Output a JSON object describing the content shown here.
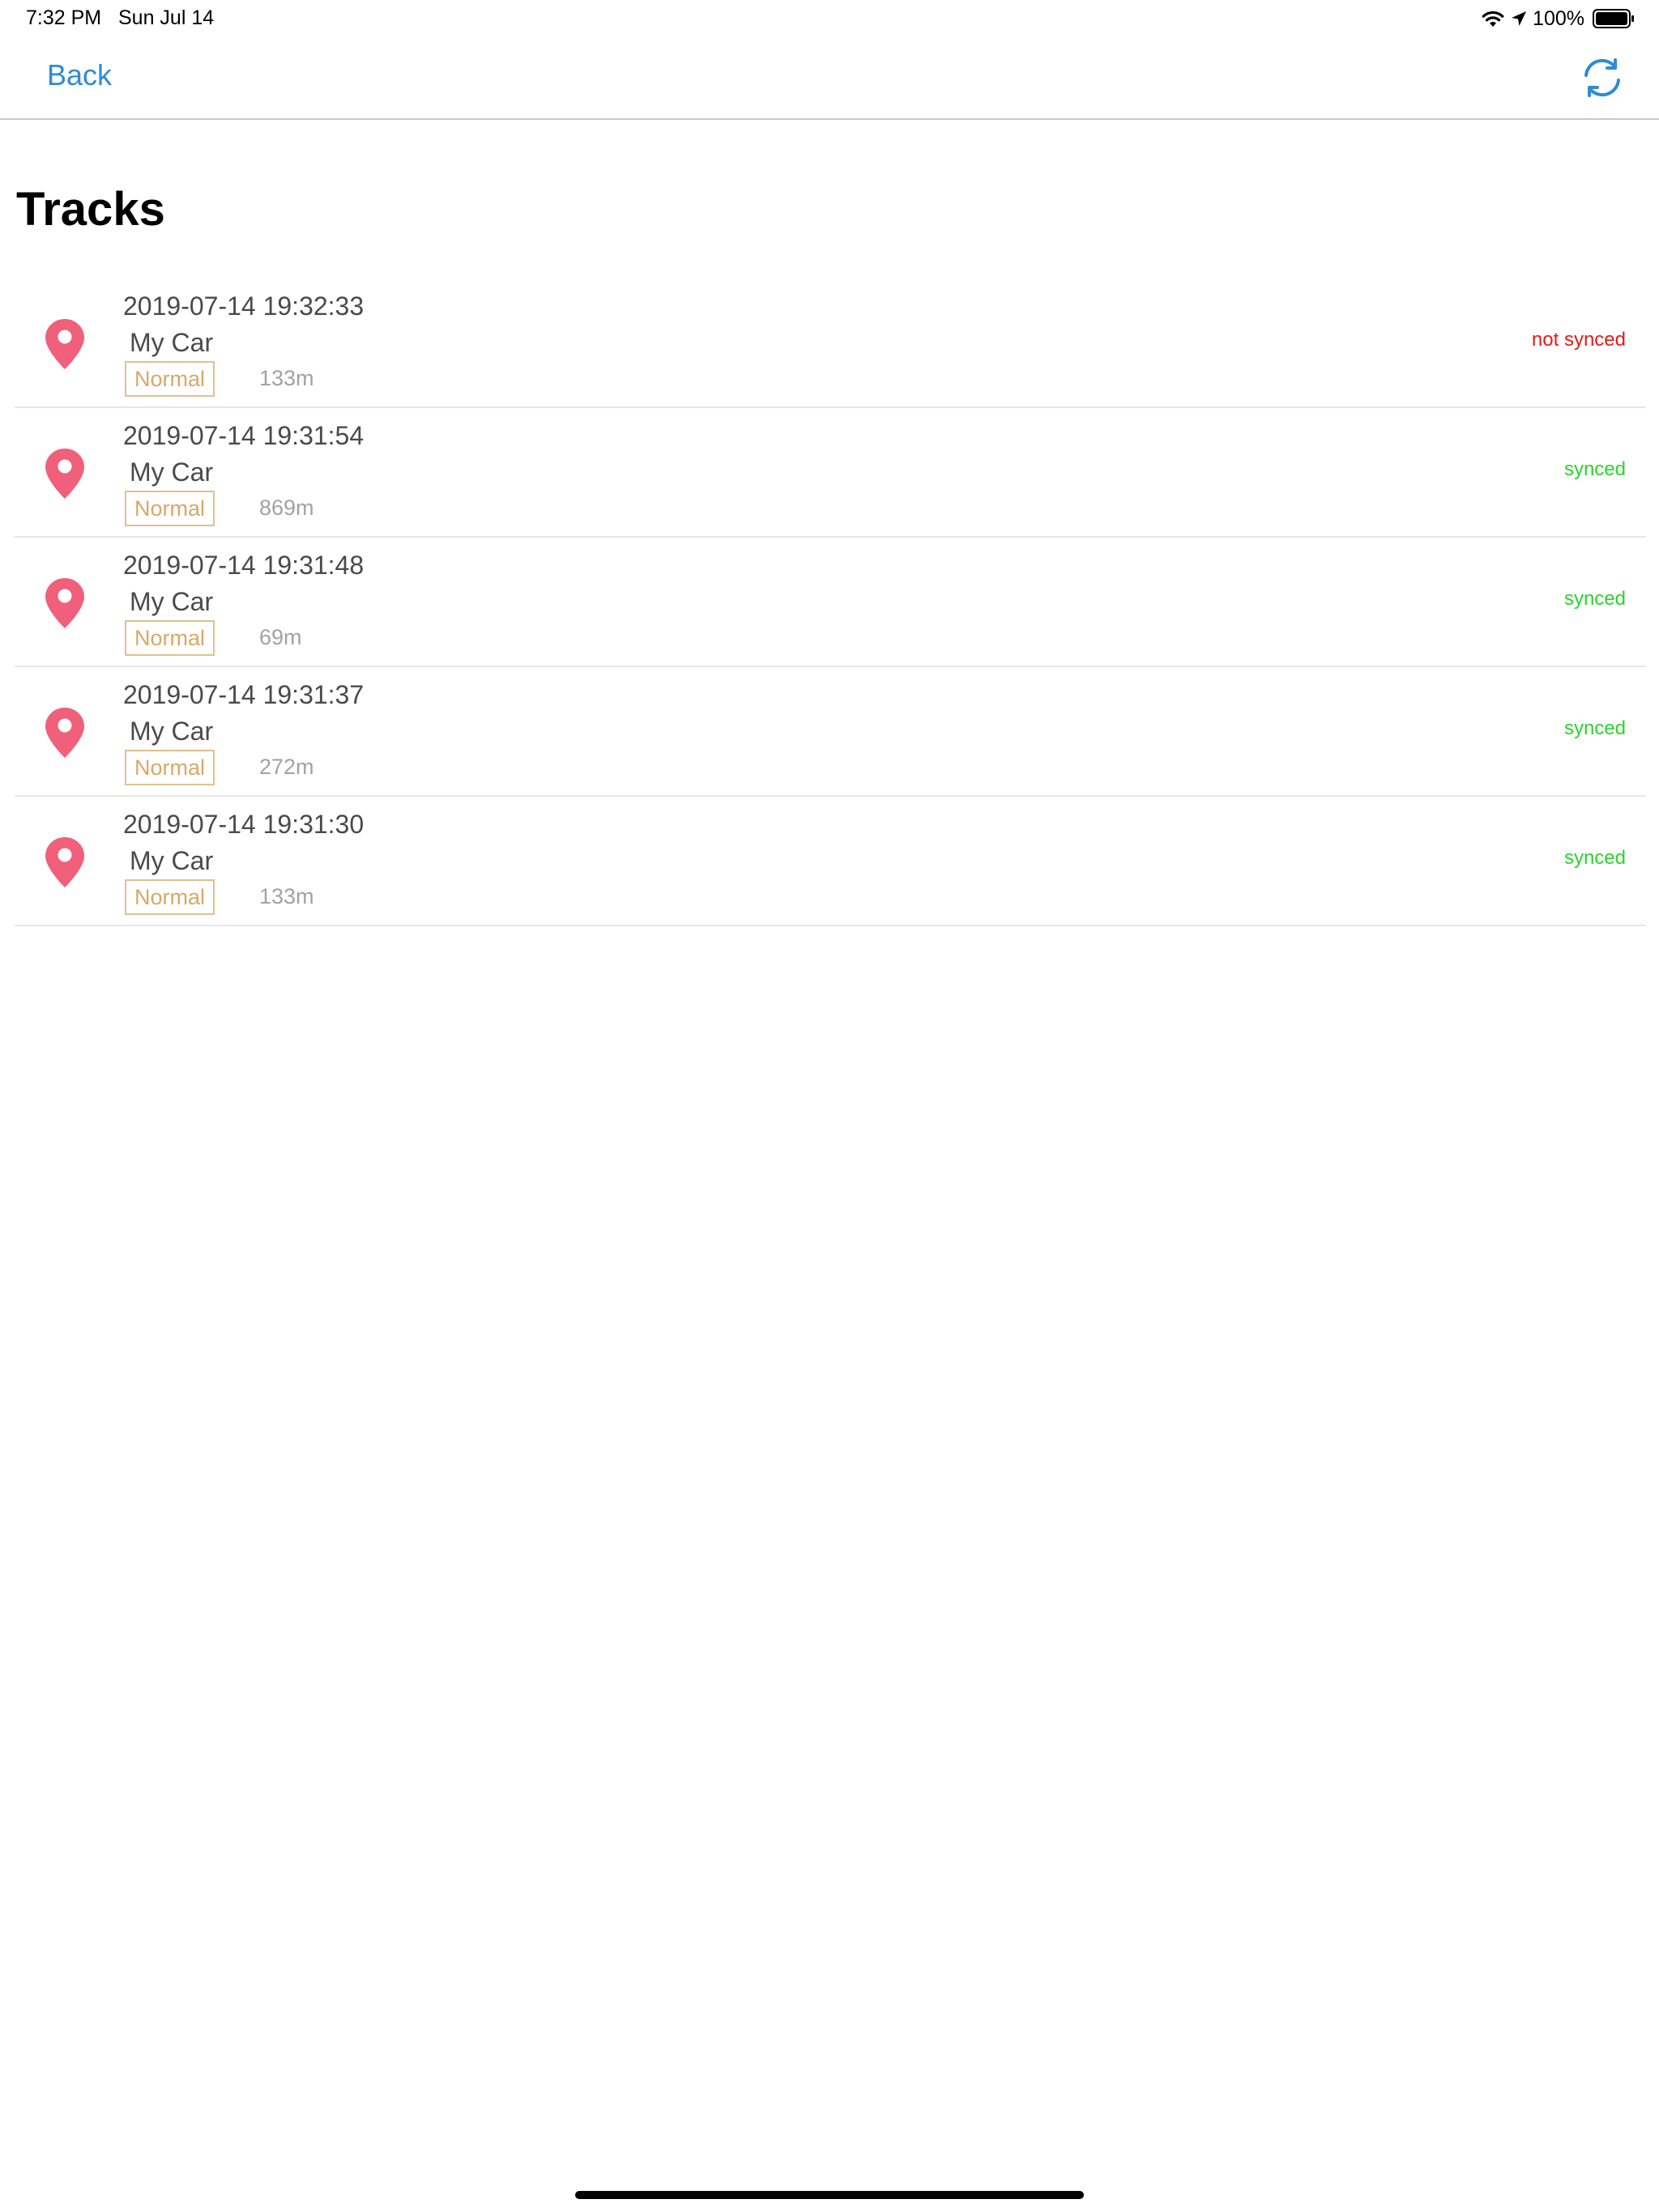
{
  "status_bar": {
    "time": "7:32 PM",
    "date": "Sun Jul 14",
    "battery": "100%",
    "icons": [
      "wifi-icon",
      "location-arrow-icon",
      "battery-icon"
    ]
  },
  "nav": {
    "back_label": "Back",
    "refresh_icon": "refresh-icon",
    "accent_color": "#2f8bd6"
  },
  "title": "Tracks",
  "colors": {
    "pin": "#f0607a",
    "not_synced": "#e8191a",
    "synced": "#2ad52a",
    "tag_border": "#e0c08e",
    "tag_text": "#d9a868"
  },
  "tracks": [
    {
      "time": "2019-07-14 19:32:33",
      "name": "My Car",
      "tag": "Normal",
      "distance": "133m",
      "status": "not synced",
      "synced": false
    },
    {
      "time": "2019-07-14 19:31:54",
      "name": "My Car",
      "tag": "Normal",
      "distance": "869m",
      "status": "synced",
      "synced": true
    },
    {
      "time": "2019-07-14 19:31:48",
      "name": "My Car",
      "tag": "Normal",
      "distance": "69m",
      "status": "synced",
      "synced": true
    },
    {
      "time": "2019-07-14 19:31:37",
      "name": "My Car",
      "tag": "Normal",
      "distance": "272m",
      "status": "synced",
      "synced": true
    },
    {
      "time": "2019-07-14 19:31:30",
      "name": "My Car",
      "tag": "Normal",
      "distance": "133m",
      "status": "synced",
      "synced": true
    }
  ]
}
